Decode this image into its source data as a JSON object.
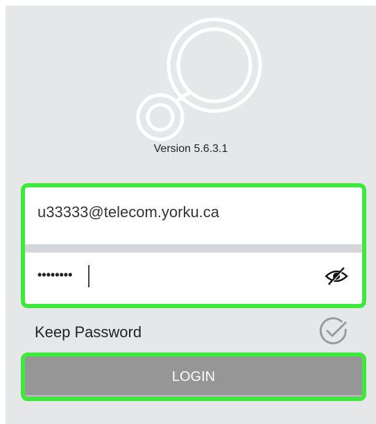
{
  "app": {
    "version_text": "Version 5.6.3.1",
    "logo_icon": "app-logo-icon"
  },
  "login_form": {
    "username_value": "u33333@telecom.yorku.ca",
    "password_masked": "••••••••",
    "password_icon": "eye-slash-icon"
  },
  "keep_password": {
    "label": "Keep Password",
    "icon": "check-circle-icon",
    "checked": false
  },
  "login_button": {
    "label": "LOGIN"
  },
  "colors": {
    "highlight": "#3ee83c",
    "background": "#e5e7e9",
    "button": "#969696"
  }
}
